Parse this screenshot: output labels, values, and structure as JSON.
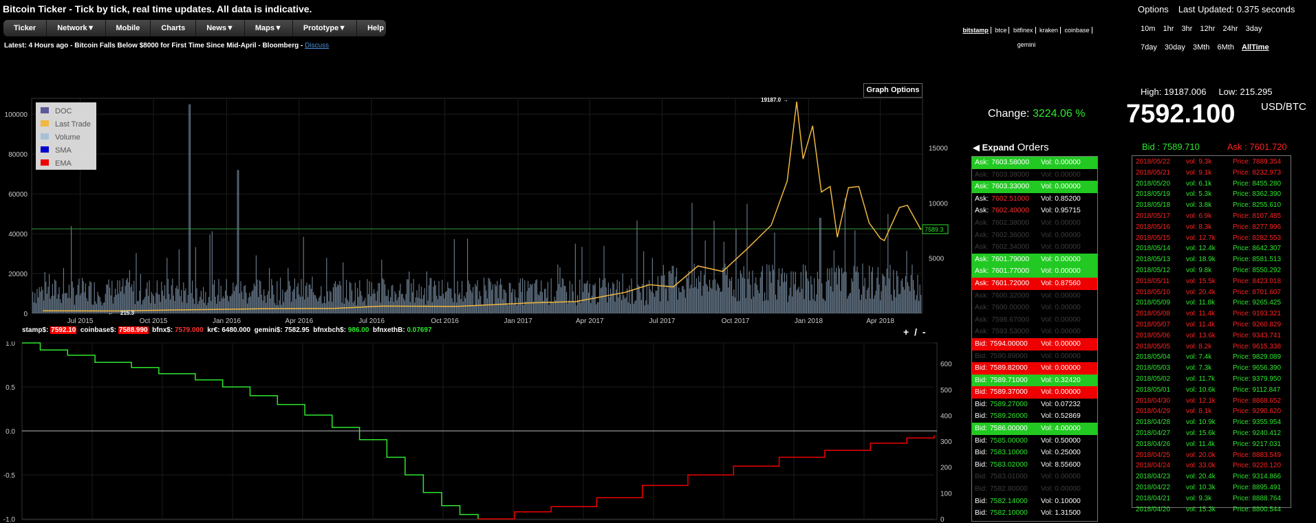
{
  "header": {
    "title": "Bitcoin Ticker - Tick by tick, real time updates. All data is indicative.",
    "menu": [
      {
        "label": "Ticker"
      },
      {
        "label": "Network▼"
      },
      {
        "label": "Mobile"
      },
      {
        "label": "Charts"
      },
      {
        "label": "News▼"
      },
      {
        "label": "Maps▼"
      },
      {
        "label": "Prototype▼"
      },
      {
        "label": "Help"
      }
    ],
    "latest_prefix": "Latest: ",
    "latest_text": "4 Hours ago - Bitcoin Falls Below $8000 for First Time Since Mid-April - Bloomberg - ",
    "latest_link": "Discuss"
  },
  "exchanges": {
    "items": [
      "bitstamp",
      "btce",
      "bitfinex",
      "kraken",
      "coinbase"
    ],
    "second_row": "gemini",
    "active": "bitstamp"
  },
  "options": {
    "label": "Options",
    "updated_label": "Last Updated:",
    "updated_value": "0.375 seconds",
    "row1": [
      "10m",
      "1hr",
      "3hr",
      "12hr",
      "24hr",
      "3day"
    ],
    "row2": [
      "7day",
      "30day",
      "3Mth",
      "6Mth",
      "AllTime"
    ],
    "active": "AllTime"
  },
  "graph_options_label": "Graph Options",
  "stats": {
    "change_label": "Change:",
    "change_value": "3224.06 %",
    "high_label": "High:",
    "high_value": "19187.006",
    "low_label": "Low:",
    "low_value": "215.295",
    "price": "7592.100",
    "pair": "USD/BTC",
    "bid_label": "Bid :",
    "bid_value": "7589.710",
    "ask_label": "Ask :",
    "ask_value": "7601.720"
  },
  "orders_header": {
    "expand": "◀ Expand",
    "label": "Orders"
  },
  "orders": [
    {
      "side": "Ask:",
      "price": "7603.58000",
      "vol": "0.00000",
      "style": "green"
    },
    {
      "side": "Ask:",
      "price": "7603.38000",
      "vol": "0.00000",
      "style": "dim"
    },
    {
      "side": "Ask:",
      "price": "7603.33000",
      "vol": "0.00000",
      "style": "green"
    },
    {
      "side": "Ask:",
      "price": "7602.51000",
      "vol": "0.85200",
      "style": "ask-plain"
    },
    {
      "side": "Ask:",
      "price": "7602.40000",
      "vol": "0.95715",
      "style": "ask-plain"
    },
    {
      "side": "Ask:",
      "price": "7602.38000",
      "vol": "0.00000",
      "style": "dim"
    },
    {
      "side": "Ask:",
      "price": "7602.36000",
      "vol": "0.00000",
      "style": "dim"
    },
    {
      "side": "Ask:",
      "price": "7602.34000",
      "vol": "0.00000",
      "style": "dim"
    },
    {
      "side": "Ask:",
      "price": "7601.79000",
      "vol": "0.00000",
      "style": "green"
    },
    {
      "side": "Ask:",
      "price": "7601.77000",
      "vol": "0.00000",
      "style": "green"
    },
    {
      "side": "Ask:",
      "price": "7601.72000",
      "vol": "0.87560",
      "style": "red"
    },
    {
      "side": "Ask:",
      "price": "7600.32000",
      "vol": "0.00000",
      "style": "dim"
    },
    {
      "side": "Ask:",
      "price": "7600.00000",
      "vol": "0.00000",
      "style": "dim"
    },
    {
      "side": "Ask:",
      "price": "7598.67000",
      "vol": "0.00000",
      "style": "dim"
    },
    {
      "side": "Ask:",
      "price": "7593.53000",
      "vol": "0.00000",
      "style": "dim"
    },
    {
      "side": "Bid:",
      "price": "7594.00000",
      "vol": "0.00000",
      "style": "red"
    },
    {
      "side": "Bid:",
      "price": "7590.89000",
      "vol": "0.00000",
      "style": "dim"
    },
    {
      "side": "Bid:",
      "price": "7589.82000",
      "vol": "0.00000",
      "style": "red"
    },
    {
      "side": "Bid:",
      "price": "7589.71000",
      "vol": "0.32420",
      "style": "green"
    },
    {
      "side": "Bid:",
      "price": "7589.37000",
      "vol": "0.00000",
      "style": "red"
    },
    {
      "side": "Bid:",
      "price": "7589.27000",
      "vol": "0.07232",
      "style": "plain"
    },
    {
      "side": "Bid:",
      "price": "7589.26000",
      "vol": "0.52869",
      "style": "plain"
    },
    {
      "side": "Bid:",
      "price": "7586.00000",
      "vol": "4.00000",
      "style": "green"
    },
    {
      "side": "Bid:",
      "price": "7585.00000",
      "vol": "0.50000",
      "style": "plain"
    },
    {
      "side": "Bid:",
      "price": "7583.10000",
      "vol": "0.25000",
      "style": "plain"
    },
    {
      "side": "Bid:",
      "price": "7583.02000",
      "vol": "8.55600",
      "style": "plain"
    },
    {
      "side": "Bid:",
      "price": "7583.01000",
      "vol": "0.00000",
      "style": "dim"
    },
    {
      "side": "Bid:",
      "price": "7582.80000",
      "vol": "0.00000",
      "style": "dim"
    },
    {
      "side": "Bid:",
      "price": "7582.14000",
      "vol": "0.10000",
      "style": "plain"
    },
    {
      "side": "Bid:",
      "price": "7582.10000",
      "vol": "1.31500",
      "style": "plain"
    }
  ],
  "history": [
    {
      "date": "2018/05/22",
      "vol": "vol: 9.3k",
      "price": "Price: 7889.354",
      "dir": "down"
    },
    {
      "date": "2018/05/21",
      "vol": "vol: 9.1k",
      "price": "Price: 8232.973",
      "dir": "down"
    },
    {
      "date": "2018/05/20",
      "vol": "vol: 6.1k",
      "price": "Price: 8455.280",
      "dir": "up"
    },
    {
      "date": "2018/05/19",
      "vol": "vol: 5.3k",
      "price": "Price: 8362.390",
      "dir": "up"
    },
    {
      "date": "2018/05/18",
      "vol": "vol: 3.8k",
      "price": "Price: 8255.610",
      "dir": "up"
    },
    {
      "date": "2018/05/17",
      "vol": "vol: 6.9k",
      "price": "Price: 8107.485",
      "dir": "down"
    },
    {
      "date": "2018/05/16",
      "vol": "vol: 8.3k",
      "price": "Price: 8277.996",
      "dir": "down"
    },
    {
      "date": "2018/05/15",
      "vol": "vol: 12.7k",
      "price": "Price: 8282.553",
      "dir": "down"
    },
    {
      "date": "2018/05/14",
      "vol": "vol: 12.4k",
      "price": "Price: 8642.307",
      "dir": "up"
    },
    {
      "date": "2018/05/13",
      "vol": "vol: 18.9k",
      "price": "Price: 8581.513",
      "dir": "up"
    },
    {
      "date": "2018/05/12",
      "vol": "vol: 9.8k",
      "price": "Price: 8550.292",
      "dir": "up"
    },
    {
      "date": "2018/05/11",
      "vol": "vol: 15.5k",
      "price": "Price: 8423.018",
      "dir": "down"
    },
    {
      "date": "2018/05/10",
      "vol": "vol: 20.4k",
      "price": "Price: 8701.607",
      "dir": "down"
    },
    {
      "date": "2018/05/09",
      "vol": "vol: 11.8k",
      "price": "Price: 9265.425",
      "dir": "up"
    },
    {
      "date": "2018/05/08",
      "vol": "vol: 11.4k",
      "price": "Price: 9193.321",
      "dir": "down"
    },
    {
      "date": "2018/05/07",
      "vol": "vol: 11.4k",
      "price": "Price: 9260.829",
      "dir": "down"
    },
    {
      "date": "2018/05/06",
      "vol": "vol: 13.6k",
      "price": "Price: 9343.741",
      "dir": "down"
    },
    {
      "date": "2018/05/05",
      "vol": "vol: 8.2k",
      "price": "Price: 9615.338",
      "dir": "down"
    },
    {
      "date": "2018/05/04",
      "vol": "vol: 7.4k",
      "price": "Price: 9829.089",
      "dir": "up"
    },
    {
      "date": "2018/05/03",
      "vol": "vol: 7.3k",
      "price": "Price: 9656.390",
      "dir": "up"
    },
    {
      "date": "2018/05/02",
      "vol": "vol: 11.7k",
      "price": "Price: 9379.950",
      "dir": "up"
    },
    {
      "date": "2018/05/01",
      "vol": "vol: 10.6k",
      "price": "Price: 9112.847",
      "dir": "up"
    },
    {
      "date": "2018/04/30",
      "vol": "vol: 12.1k",
      "price": "Price: 8868.652",
      "dir": "down"
    },
    {
      "date": "2018/04/29",
      "vol": "vol: 8.1k",
      "price": "Price: 9290.620",
      "dir": "down"
    },
    {
      "date": "2018/04/28",
      "vol": "vol: 10.9k",
      "price": "Price: 9355.954",
      "dir": "up"
    },
    {
      "date": "2018/04/27",
      "vol": "vol: 15.6k",
      "price": "Price: 9240.412",
      "dir": "up"
    },
    {
      "date": "2018/04/26",
      "vol": "vol: 11.4k",
      "price": "Price: 9217.031",
      "dir": "up"
    },
    {
      "date": "2018/04/25",
      "vol": "vol: 20.0k",
      "price": "Price: 8883.549",
      "dir": "down"
    },
    {
      "date": "2018/04/24",
      "vol": "vol: 33.0k",
      "price": "Price: 9220.120",
      "dir": "down"
    },
    {
      "date": "2018/04/23",
      "vol": "vol: 20.4k",
      "price": "Price: 9314.866",
      "dir": "up"
    },
    {
      "date": "2018/04/22",
      "vol": "vol: 10.3k",
      "price": "Price: 8895.491",
      "dir": "up"
    },
    {
      "date": "2018/04/21",
      "vol": "vol: 9.3k",
      "price": "Price: 8888.764",
      "dir": "up"
    },
    {
      "date": "2018/04/20",
      "vol": "vol: 15.3k",
      "price": "Price: 8800.544",
      "dir": "up"
    }
  ],
  "ticker_strip": {
    "stamp_label": "stamp$:",
    "stamp_value": "7592.10",
    "coinbase_label": "coinbase$:",
    "coinbase_value": "7588.990",
    "bfnx_label": "bfnx$:",
    "bfnx_value": "7579.000",
    "kr_label": "kr€:",
    "kr_value": "6480.000",
    "gemini_label": "gemini$:",
    "gemini_value": "7582.95",
    "bfnxbch_label": "bfnxbch$:",
    "bfnxbch_value": "986.00",
    "bfnxeth_label": "bfnxethB:",
    "bfnxeth_value": "0.07697"
  },
  "plus_minus": "+ / -",
  "chart_data": [
    {
      "type": "line",
      "legend": [
        "DOC",
        "Last Trade",
        "Volume",
        "SMA",
        "EMA"
      ],
      "colors": {
        "DOC": "#5a5a9a",
        "Last Trade": "#f0b840",
        "Volume": "#a8c0d8",
        "SMA": "#0000cc",
        "EMA": "#ee0000"
      },
      "x_ticks": [
        "Jul 2015",
        "Oct 2015",
        "Jan 2016",
        "Apr 2016",
        "Jul 2016",
        "Oct 2016",
        "Jan 2017",
        "Apr 2017",
        "Jul 2017",
        "Oct 2017",
        "Jan 2018",
        "Apr 2018"
      ],
      "x_range": [
        "2015-05",
        "2018-05"
      ],
      "y_left_ticks": [
        "100000",
        "80000",
        "60000",
        "40000",
        "20000",
        "0"
      ],
      "y_left_range": [
        0,
        108000
      ],
      "y_right_ticks": [
        "15000",
        "10000",
        "5000"
      ],
      "y_right_range": [
        0,
        19187
      ],
      "current_marker": "7589.3",
      "high_annotation": "19187.0",
      "low_annotation": "215.3",
      "price_series": [
        [
          "2015-05",
          237
        ],
        [
          "2015-08",
          215.3
        ],
        [
          "2015-11",
          330
        ],
        [
          "2016-02",
          420
        ],
        [
          "2016-05",
          450
        ],
        [
          "2016-07",
          660
        ],
        [
          "2016-10",
          630
        ],
        [
          "2017-01",
          950
        ],
        [
          "2017-03",
          1080
        ],
        [
          "2017-05",
          1900
        ],
        [
          "2017-06",
          2600
        ],
        [
          "2017-07",
          2400
        ],
        [
          "2017-08",
          4300
        ],
        [
          "2017-09",
          3800
        ],
        [
          "2017-10",
          5800
        ],
        [
          "2017-11",
          8000
        ],
        [
          "2017-12-05",
          12000
        ],
        [
          "2017-12-17",
          19187
        ],
        [
          "2017-12-25",
          14000
        ],
        [
          "2018-01-06",
          17000
        ],
        [
          "2018-01-17",
          11000
        ],
        [
          "2018-01-28",
          11500
        ],
        [
          "2018-02-06",
          6900
        ],
        [
          "2018-02-20",
          11400
        ],
        [
          "2018-03-05",
          11500
        ],
        [
          "2018-03-18",
          8200
        ],
        [
          "2018-04-01",
          6800
        ],
        [
          "2018-04-06",
          6600
        ],
        [
          "2018-04-25",
          9600
        ],
        [
          "2018-05-05",
          9800
        ],
        [
          "2018-05-15",
          8500
        ],
        [
          "2018-05-22",
          7589.3
        ]
      ],
      "volume_peaks": [
        [
          "2015-11",
          105000
        ],
        [
          "2016-01",
          72000
        ],
        [
          "2017-10",
          55000
        ],
        [
          "2018-01",
          48000
        ]
      ]
    },
    {
      "type": "line",
      "y_left_ticks": [
        "1.0",
        "0.5",
        "0.0",
        "-0.5",
        "-1.0"
      ],
      "y_left_range": [
        -1.0,
        1.0
      ],
      "y_right_ticks": [
        "600",
        "500",
        "400",
        "300",
        "200",
        "100",
        "0"
      ],
      "y_right_range": [
        0,
        680
      ],
      "series": [
        {
          "values": [
            [
              0,
              1.0
            ],
            [
              2,
              0.92
            ],
            [
              5,
              0.86
            ],
            [
              8,
              0.78
            ],
            [
              12,
              0.72
            ],
            [
              15,
              0.65
            ],
            [
              19,
              0.58
            ],
            [
              22,
              0.5
            ],
            [
              25,
              0.4
            ],
            [
              28,
              0.3
            ],
            [
              31,
              0.18
            ],
            [
              34,
              0.04
            ],
            [
              37,
              -0.1
            ],
            [
              40,
              -0.3
            ],
            [
              42,
              -0.5
            ],
            [
              44,
              -0.7
            ],
            [
              46,
              -0.85
            ],
            [
              48,
              -0.95
            ],
            [
              50,
              -1.0
            ]
          ]
        },
        {
          "values": [
            [
              50,
              -1.0
            ],
            [
              54,
              -0.92
            ],
            [
              58,
              -0.86
            ],
            [
              63,
              -0.76
            ],
            [
              68,
              -0.62
            ],
            [
              73,
              -0.5
            ],
            [
              78,
              -0.4
            ],
            [
              83,
              -0.3
            ],
            [
              88,
              -0.22
            ],
            [
              93,
              -0.14
            ],
            [
              97,
              -0.08
            ],
            [
              100,
              -0.05
            ]
          ]
        }
      ]
    }
  ]
}
